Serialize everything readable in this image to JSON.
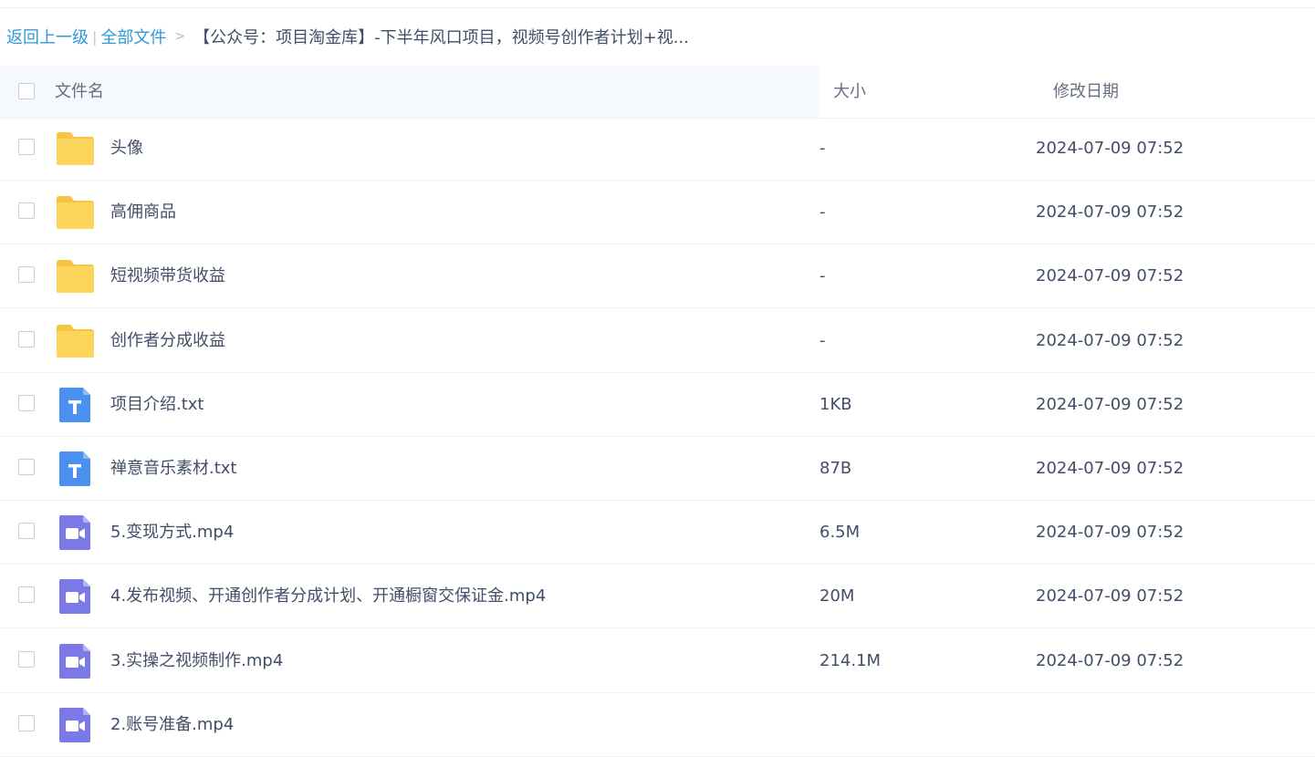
{
  "breadcrumb": {
    "back": "返回上一级",
    "separator": "|",
    "all_files": "全部文件",
    "arrow": ">",
    "current": "【公众号：项目淘金库】-下半年风口项目，视频号创作者计划+视..."
  },
  "table": {
    "headers": {
      "name": "文件名",
      "size": "大小",
      "date": "修改日期"
    },
    "rows": [
      {
        "type": "folder",
        "icon": "folder-icon",
        "name": "头像",
        "size": "-",
        "date": "2024-07-09 07:52"
      },
      {
        "type": "folder",
        "icon": "folder-icon",
        "name": "高佣商品",
        "size": "-",
        "date": "2024-07-09 07:52"
      },
      {
        "type": "folder",
        "icon": "folder-icon",
        "name": "短视频带货收益",
        "size": "-",
        "date": "2024-07-09 07:52"
      },
      {
        "type": "folder",
        "icon": "folder-icon",
        "name": "创作者分成收益",
        "size": "-",
        "date": "2024-07-09 07:52"
      },
      {
        "type": "txt",
        "icon": "text-file-icon",
        "name": "项目介绍.txt",
        "size": "1KB",
        "date": "2024-07-09 07:52"
      },
      {
        "type": "txt",
        "icon": "text-file-icon",
        "name": "禅意音乐素材.txt",
        "size": "87B",
        "date": "2024-07-09 07:52"
      },
      {
        "type": "video",
        "icon": "video-file-icon",
        "name": "5.变现方式.mp4",
        "size": "6.5M",
        "date": "2024-07-09 07:52"
      },
      {
        "type": "video",
        "icon": "video-file-icon",
        "name": "4.发布视频、开通创作者分成计划、开通橱窗交保证金.mp4",
        "size": "20M",
        "date": "2024-07-09 07:52"
      },
      {
        "type": "video",
        "icon": "video-file-icon",
        "name": "3.实操之视频制作.mp4",
        "size": "214.1M",
        "date": "2024-07-09 07:52"
      },
      {
        "type": "video",
        "icon": "video-file-icon",
        "name": "2.账号准备.mp4",
        "size": "",
        "date": ""
      }
    ]
  },
  "colors": {
    "link": "#2e9bd6",
    "folder": "#fdd55c",
    "text_file": "#4a90f0",
    "video_file": "#7b79e8",
    "header_bg": "#f5f8fc"
  }
}
